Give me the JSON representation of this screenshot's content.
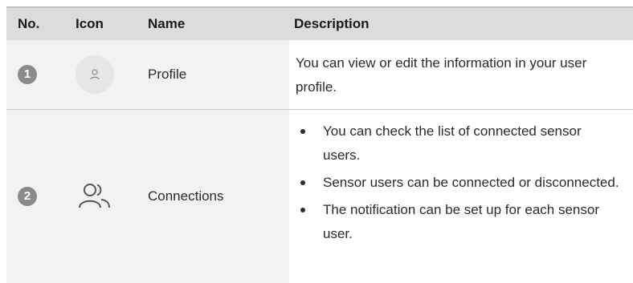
{
  "table": {
    "headers": {
      "no": "No.",
      "icon": "Icon",
      "name": "Name",
      "description": "Description"
    },
    "rows": [
      {
        "no": "1",
        "icon": "profile-icon",
        "name": "Profile",
        "description": "You can view or edit the information in your user profile."
      },
      {
        "no": "2",
        "icon": "connections-icon",
        "name": "Connections",
        "bullets": [
          "You can check the list of connected sensor users.",
          "Sensor users can be connected or disconnected.",
          "The notification can be set up for each sensor user."
        ]
      }
    ]
  }
}
